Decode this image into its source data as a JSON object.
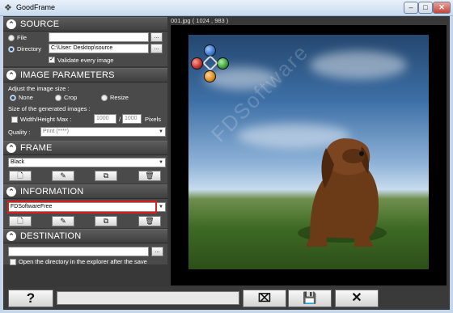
{
  "window": {
    "title": "GoodFrame"
  },
  "source": {
    "title": "SOURCE",
    "file_label": "File",
    "directory_label": "Directory",
    "directory_value": "C:\\User:            Desktop\\source",
    "browse": "...",
    "validate_label": "Validate every image"
  },
  "params": {
    "title": "IMAGE PARAMETERS",
    "adjust_label": "Adjust the image size :",
    "options": [
      "None",
      "Crop",
      "Resize"
    ],
    "selected": "None",
    "size_label": "Size of the generated images :",
    "wh_label": "Width/Height Max :",
    "width": "1000",
    "sep": "/",
    "height": "1000",
    "unit": "Pixels",
    "quality_label": "Quality :",
    "quality_value": "Print (****)"
  },
  "frame": {
    "title": "FRAME",
    "value": "Black"
  },
  "information": {
    "title": "INFORMATION",
    "value": "FDSoftwareFree"
  },
  "destination": {
    "title": "DESTINATION",
    "browse": "...",
    "open_label": "Open the directory in the explorer after the save"
  },
  "preview": {
    "title": "001.jpg ( 1024 , 983 )",
    "watermark": "FDSoftware"
  },
  "bottom": {
    "help": "?"
  },
  "colors": {
    "accent_red": "#e11c1c",
    "nav_red": "#c0302a",
    "nav_blue": "#3a74c9",
    "nav_green": "#3d9a3a",
    "nav_orange": "#d98b1e"
  }
}
